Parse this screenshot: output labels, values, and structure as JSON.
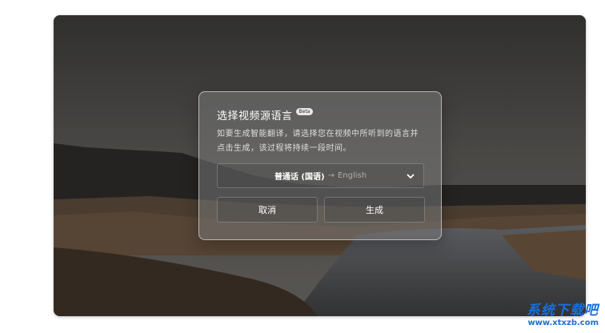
{
  "dialog": {
    "title": "选择视频源语言",
    "badge": "Beta",
    "description": "如要生成智能翻译，请选择您在视频中所听到的语言并点击生成，该过程将持续一段时间。",
    "language_select": {
      "source": "普通话 (国语)",
      "arrow": "→",
      "target": "English",
      "icon": "chevron-down-icon"
    },
    "cancel_label": "取消",
    "generate_label": "生成"
  },
  "watermark": {
    "brand": "系统下载吧",
    "url": "www.xtxzb.com"
  },
  "colors": {
    "watermark": "#1a6fd8",
    "dialog_bg": "rgba(120,120,120,0.55)"
  }
}
